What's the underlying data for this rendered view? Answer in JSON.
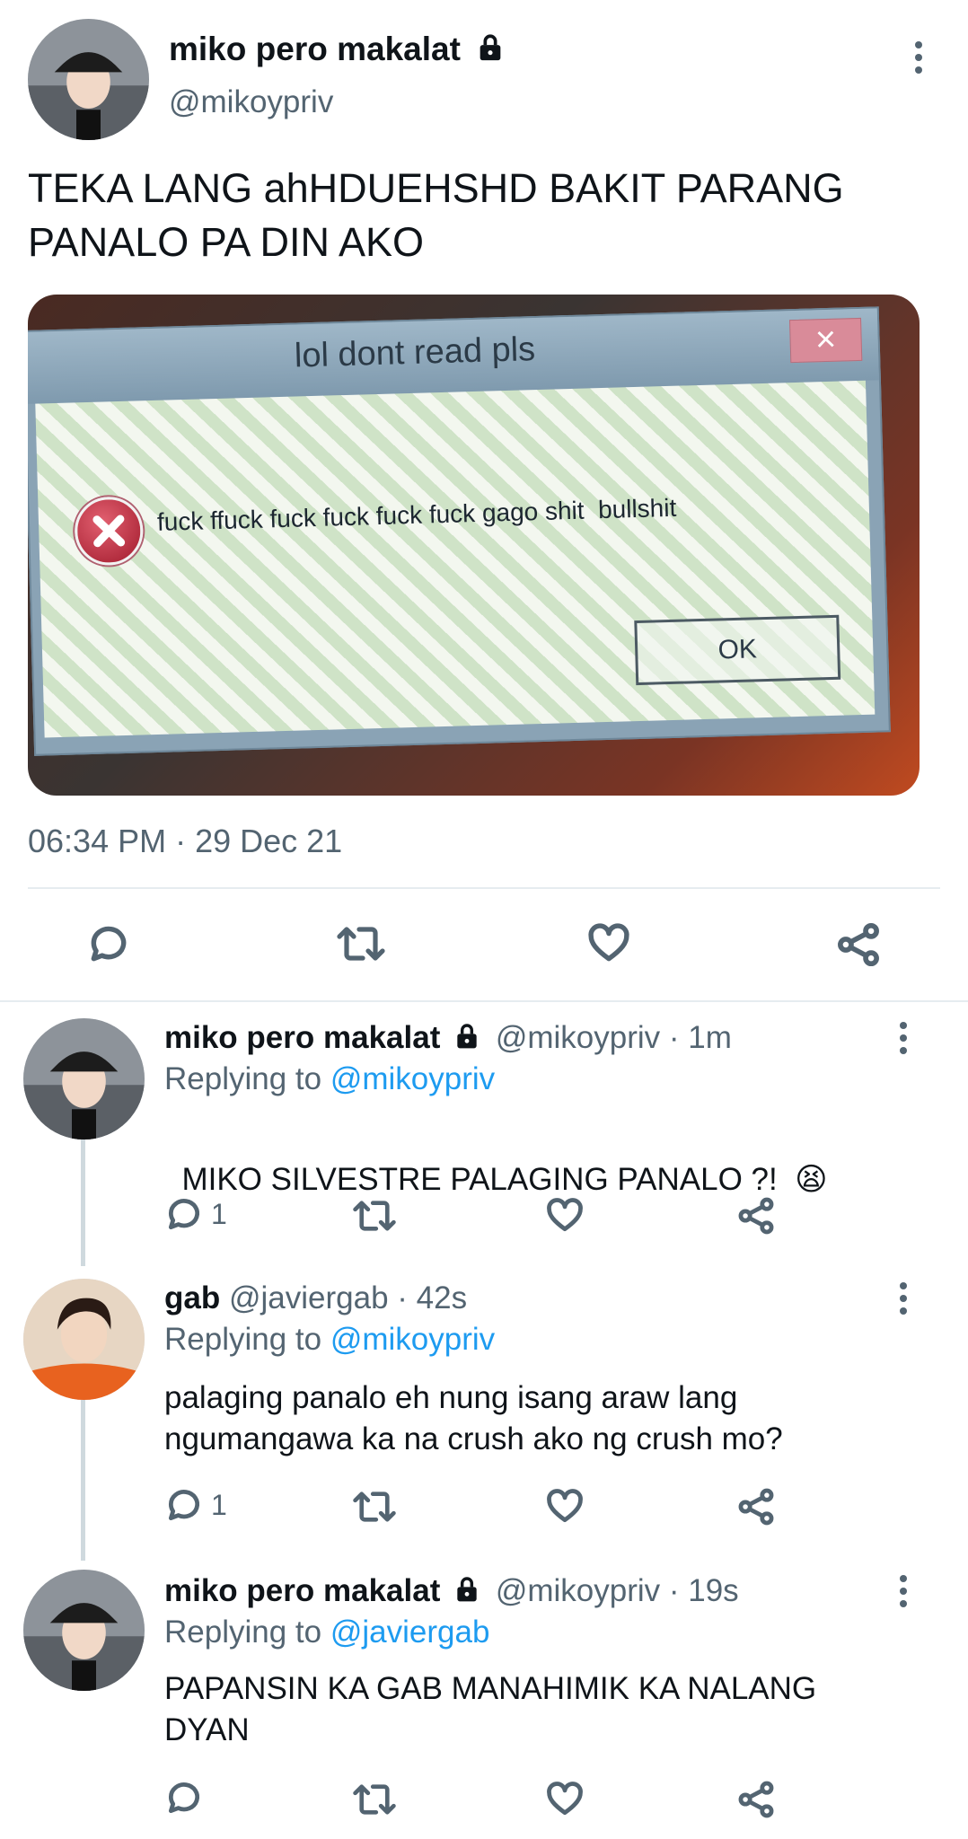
{
  "main_tweet": {
    "display_name": "miko pero makalat",
    "handle": "@mikoypriv",
    "text_line1": "TEKA LANG ahHDUEHSHD BAKIT PARANG",
    "text_line2": "PANALO PA DIN AKO",
    "image": {
      "dialog_title": "lol dont read pls",
      "dialog_message": "fuck ffuck fuck fuck fuck fuck gago shit  bullshit",
      "ok_label": "OK",
      "close_glyph": "×"
    },
    "timestamp": "06:34 PM · 29 Dec 21"
  },
  "replies": [
    {
      "display_name": "miko pero makalat",
      "handle": "@mikoypriv",
      "time": "· 1m",
      "replying_prefix": "Replying to",
      "replying_to": "@mikoypriv",
      "text_line1": "MIKO SILVESTRE PALAGING PANALO ?!  ",
      "emoji": "😫",
      "text_line2": "",
      "reply_count": "1"
    },
    {
      "display_name": "gab",
      "handle": "@javiergab",
      "time": "· 42s",
      "replying_prefix": "Replying to",
      "replying_to": "@mikoypriv",
      "text_line1": "palaging panalo eh nung isang araw lang",
      "emoji": "",
      "text_line2": "ngumangawa ka na crush ako ng crush mo?",
      "reply_count": "1"
    },
    {
      "display_name": "miko pero makalat",
      "handle": "@mikoypriv",
      "time": "· 19s",
      "replying_prefix": "Replying to",
      "replying_to": "@javiergab",
      "text_line1": "PAPANSIN KA GAB MANAHIMIK KA NALANG",
      "emoji": "",
      "text_line2": "DYAN",
      "reply_count": ""
    }
  ],
  "colors": {
    "link": "#1d9bf0",
    "muted": "#536471",
    "divider": "#e6ecf0"
  }
}
